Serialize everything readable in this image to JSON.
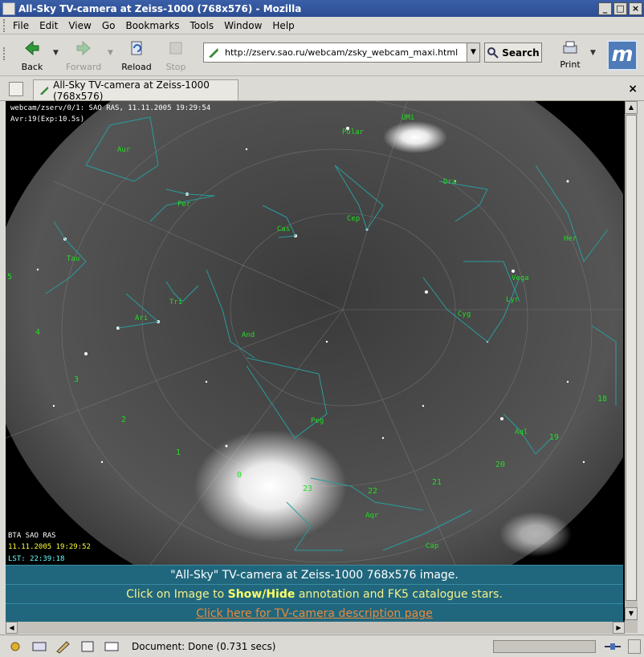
{
  "window": {
    "title": "All-Sky TV-camera at Zeiss-1000 (768x576) - Mozilla"
  },
  "menu": [
    {
      "label": "File"
    },
    {
      "label": "Edit"
    },
    {
      "label": "View"
    },
    {
      "label": "Go"
    },
    {
      "label": "Bookmarks"
    },
    {
      "label": "Tools"
    },
    {
      "label": "Window"
    },
    {
      "label": "Help"
    }
  ],
  "nav": {
    "back": "Back",
    "forward": "Forward",
    "reload": "Reload",
    "stop": "Stop",
    "url": "http://zserv.sao.ru/webcam/zsky_webcam_maxi.html",
    "search": "Search",
    "print": "Print"
  },
  "tab": {
    "label": "All-Sky TV-camera at Zeiss-1000 (768x576)"
  },
  "sky": {
    "header_line1": "webcam/zserv/0/1: SAO RAS, 11.11.2005 19:29:54",
    "header_line2": "Avr:19(Exp:10.5s)",
    "footer_site": "BTA SAO RAS",
    "footer_datetime": "11.11.2005 19:29:52",
    "footer_lst": "LST: 22:39:18",
    "constellations": [
      "UMi",
      "Polar",
      "Aur",
      "Dra",
      "Per",
      "Cep",
      "Cas",
      "Tau",
      "Her",
      "Vega",
      "Tri",
      "Lyr",
      "Ari",
      "Cyg",
      "And",
      "Peg",
      "Aql",
      "Aqr",
      "Cap"
    ],
    "hour_marks": [
      "5",
      "4",
      "3",
      "2",
      "1",
      "0",
      "23",
      "22",
      "21",
      "20",
      "19",
      "18"
    ],
    "colors": {
      "annotation": "#2a9c9c",
      "label": "#22dd22",
      "caption_bg": "#20677d"
    }
  },
  "caption": {
    "line1": "\"All-Sky\" TV-camera at Zeiss-1000 768x576 image.",
    "line2_pre": "Click on Image to",
    "line2_bold": "Show/Hide",
    "line2_post": "annotation and FK5 catalogue stars.",
    "line3": "Click here for TV-camera description page"
  },
  "status": {
    "text": "Document: Done (0.731 secs)"
  }
}
